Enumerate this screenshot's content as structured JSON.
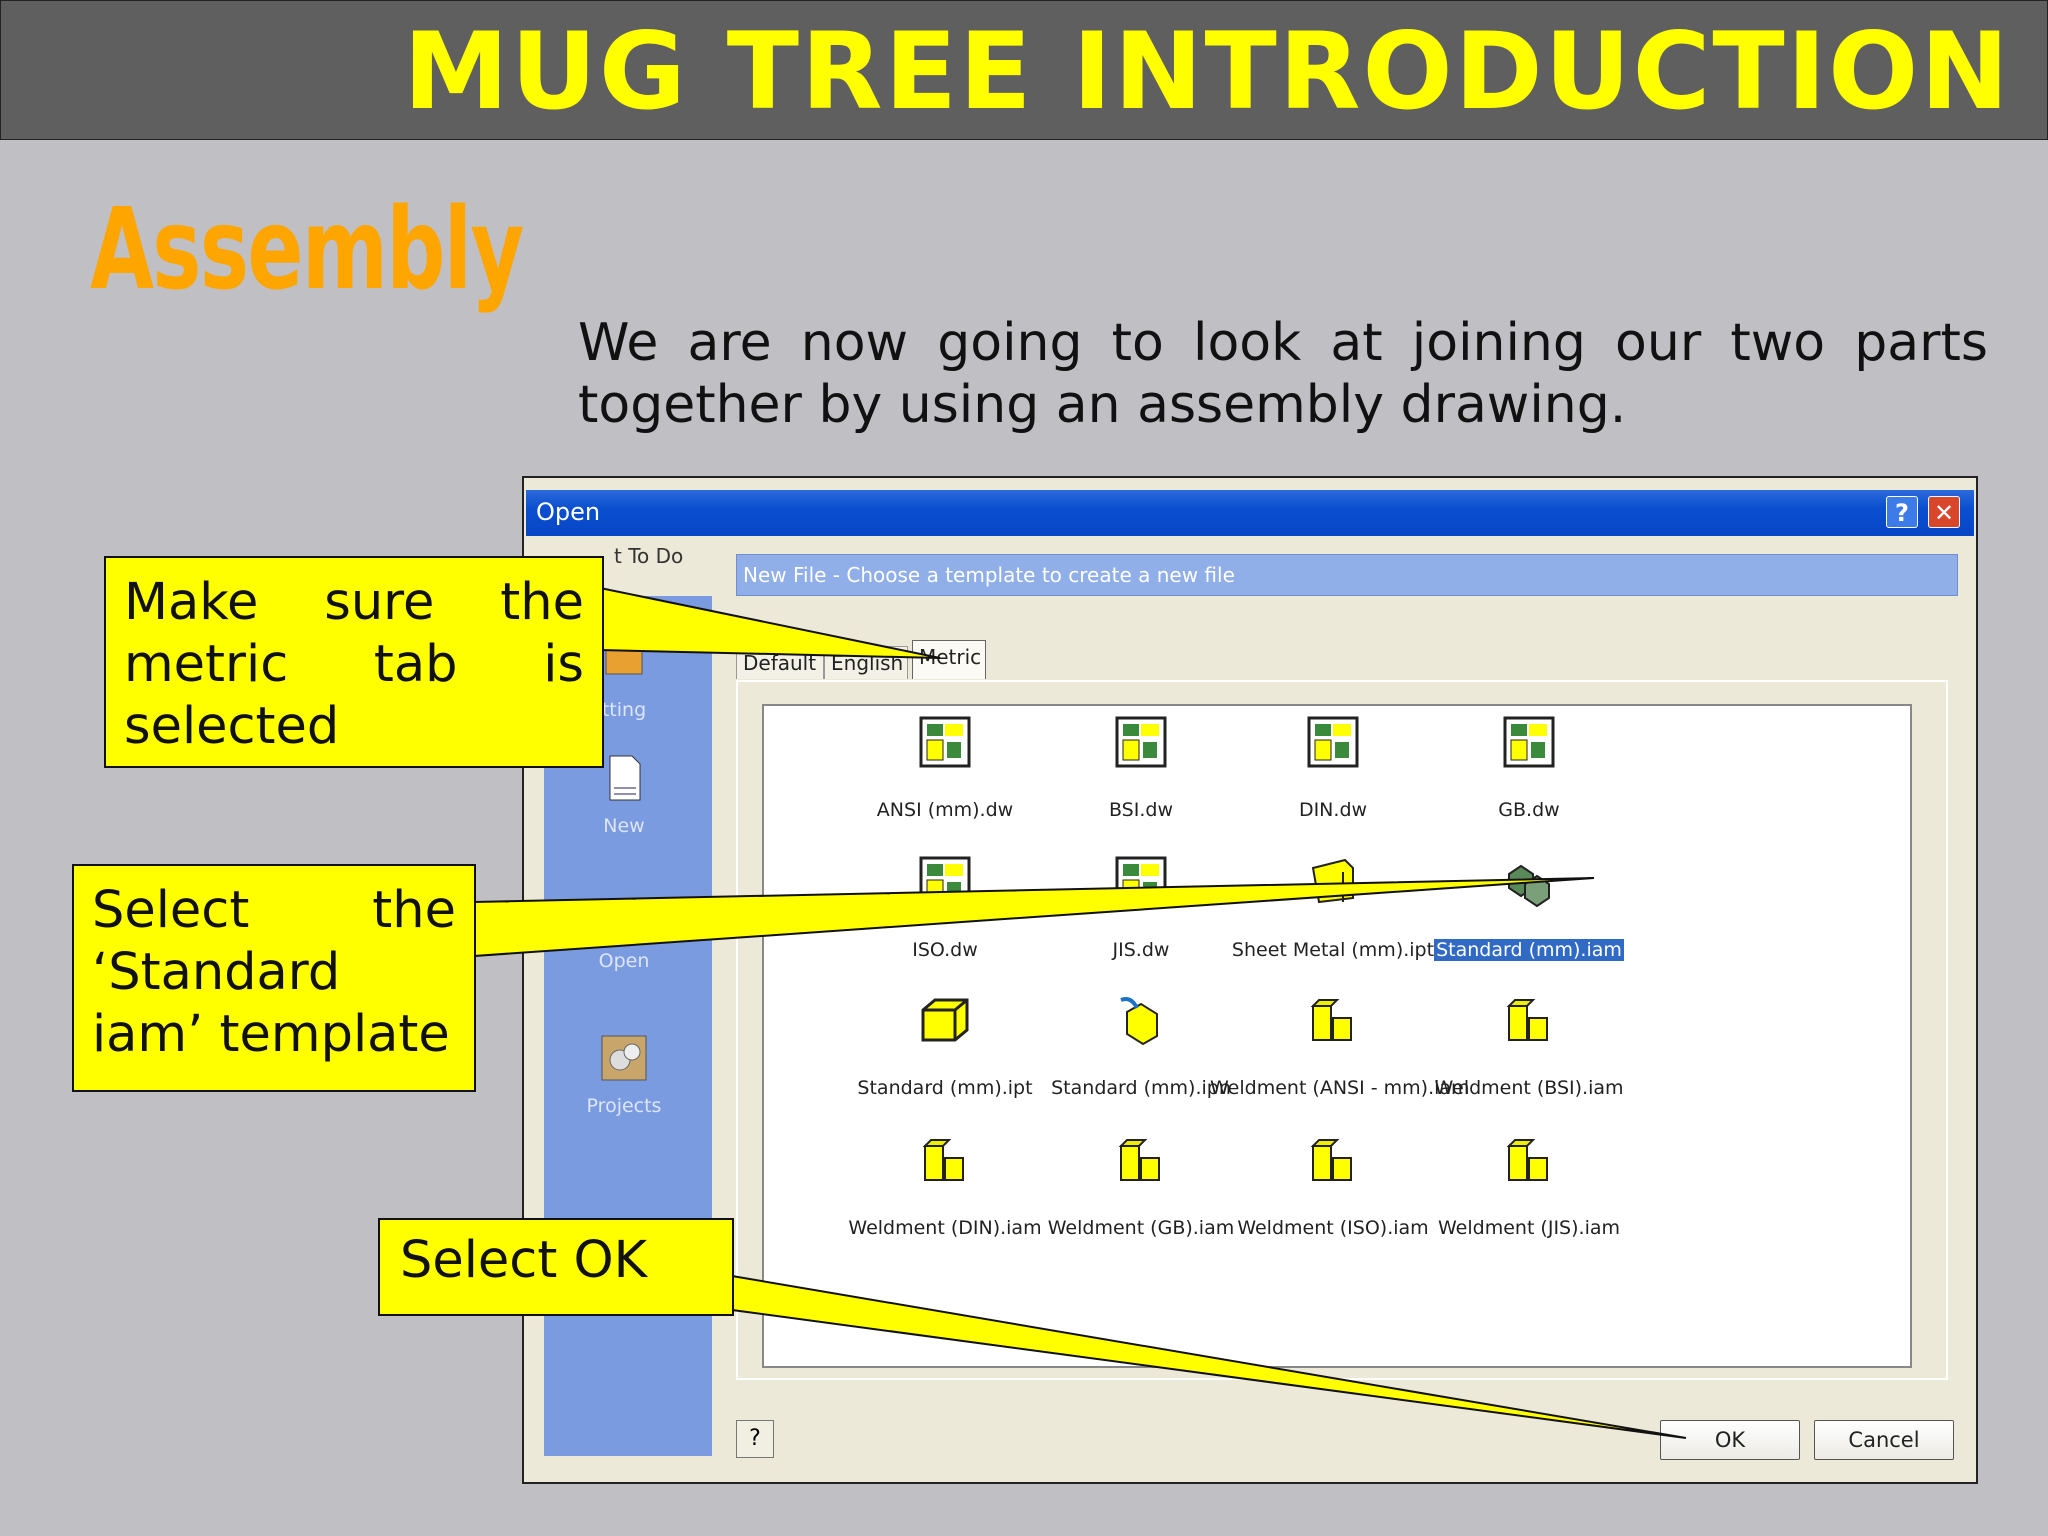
{
  "slide": {
    "title": "MUG TREE INTRODUCTION",
    "section": "Assembly",
    "intro": "We are now going to look at joining our two parts together by using an assembly drawing."
  },
  "dialog": {
    "title": "Open",
    "help_glyph": "?",
    "close_glyph": "✕",
    "sidebar": {
      "top_label": "t To Do",
      "items": [
        "tting",
        "New",
        "Open",
        "Projects"
      ]
    },
    "banner": "New File - Choose a template to create a new file",
    "tabs": [
      "Default",
      "English",
      "Metric"
    ],
    "active_tab": "Metric",
    "files": [
      {
        "label": "ANSI (mm).dw",
        "icon": "drawing-icon"
      },
      {
        "label": "BSI.dw",
        "icon": "drawing-icon"
      },
      {
        "label": "DIN.dw",
        "icon": "drawing-icon"
      },
      {
        "label": "GB.dw",
        "icon": "drawing-icon"
      },
      {
        "label": "ISO.dw",
        "icon": "drawing-icon"
      },
      {
        "label": "JIS.dw",
        "icon": "drawing-icon"
      },
      {
        "label": "Sheet Metal (mm).ipt",
        "icon": "sheet-metal-icon"
      },
      {
        "label": "Standard (mm).iam",
        "icon": "assembly-icon"
      },
      {
        "label": "Standard (mm).ipt",
        "icon": "part-icon"
      },
      {
        "label": "Standard (mm).ipn",
        "icon": "presentation-icon"
      },
      {
        "label": "Weldment (ANSI - mm).iam",
        "icon": "weldment-icon"
      },
      {
        "label": "Weldment (BSI).iam",
        "icon": "weldment-icon"
      },
      {
        "label": "Weldment (DIN).iam",
        "icon": "weldment-icon"
      },
      {
        "label": "Weldment (GB).iam",
        "icon": "weldment-icon"
      },
      {
        "label": "Weldment (ISO).iam",
        "icon": "weldment-icon"
      },
      {
        "label": "Weldment (JIS).iam",
        "icon": "weldment-icon"
      }
    ],
    "selected_file": "Standard (mm).iam",
    "help_button": "?",
    "ok_label": "OK",
    "cancel_label": "Cancel"
  },
  "callouts": {
    "metric": "Make sure the metric tab is selected",
    "template": "Select the ‘Standard iam’ template",
    "ok": "Select OK"
  },
  "colors": {
    "header_bg": "#5f5f5f",
    "title_text": "#ffff00",
    "section_text": "#ffa500",
    "callout_bg": "#ffff00",
    "page_bg": "#c0bfc3",
    "titlebar": "#0a4fd0",
    "sidebar": "#7b9be0",
    "selection": "#316ac5"
  }
}
